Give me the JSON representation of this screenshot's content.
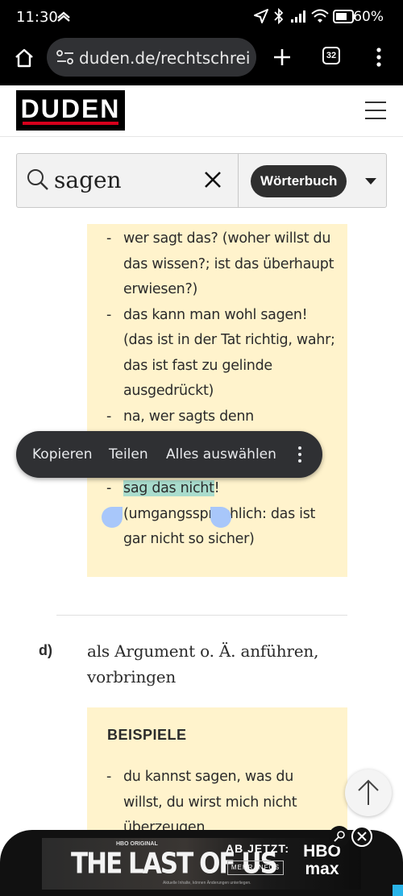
{
  "status_bar": {
    "time": "11:30",
    "battery": "60%"
  },
  "browser": {
    "url": "duden.de/rechtschreibu",
    "tab_count": "32"
  },
  "site": {
    "logo": "DUDEN"
  },
  "search": {
    "query": "sagen",
    "dictionary": "Wörterbuch"
  },
  "examples_1": {
    "items": [
      "wer sagt das? (woher willst du das wissen?; ist das überhaupt erwiesen?)",
      "das kann man wohl sagen! (das ist in der Tat richtig, wahr; das ist fast zu gelinde ausgedrückt)",
      "na, wer sagts denn"
    ],
    "selected_item": {
      "highlighted": "sag das nicht",
      "rest_first_line": "!",
      "rest": "(umgangssprachlich: das ist gar nicht so sicher)"
    }
  },
  "context_menu": {
    "copy": "Kopieren",
    "share": "Teilen",
    "select_all": "Alles auswählen"
  },
  "definition": {
    "letter": "d)",
    "text": "als Argument o. Ä. anführen, vorbringen"
  },
  "examples_2": {
    "heading": "BEISPIELE",
    "items": [
      "du kannst sagen, was du willst, du wirst mich nicht überzeugen"
    ]
  },
  "ad": {
    "network_tag": "HBO ORIGINAL",
    "title": "THE LAST OF US",
    "cta_heading": "AB JETZT:",
    "cta_button": "MEHR INFOS",
    "brand": "HBO max",
    "fine_print": "Aktuelle Inhalte, können Änderungen unterliegen."
  },
  "colors": {
    "highlight": "#a9dccd",
    "example_bg": "#fff3cc",
    "selection_handle": "#a8c7fa",
    "logo_red": "#d6001c"
  }
}
